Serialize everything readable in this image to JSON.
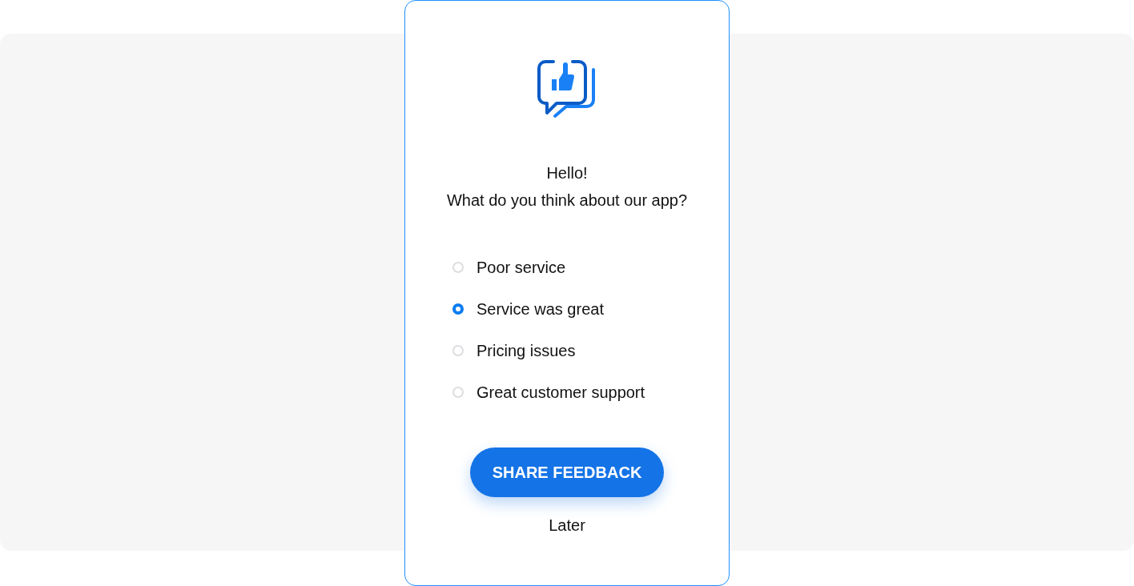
{
  "dialog": {
    "greeting": "Hello!",
    "question": "What do you think about our app?",
    "options": [
      {
        "label": "Poor service",
        "selected": false
      },
      {
        "label": "Service was great",
        "selected": true
      },
      {
        "label": "Pricing issues",
        "selected": false
      },
      {
        "label": "Great customer support",
        "selected": false
      }
    ],
    "primary_button": "SHARE FEEDBACK",
    "secondary_link": "Later"
  }
}
